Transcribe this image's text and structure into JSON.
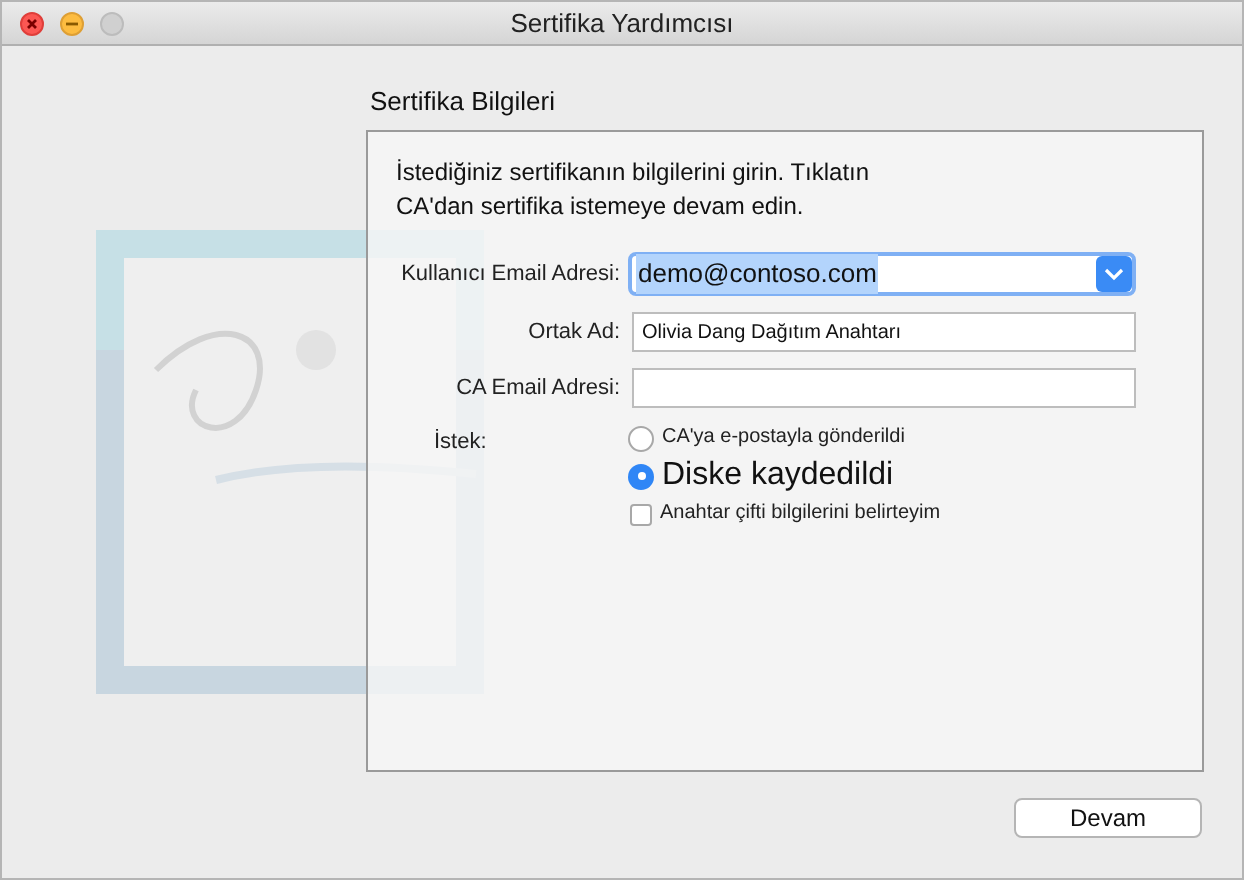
{
  "window": {
    "title": "Sertifika Yardımcısı"
  },
  "heading": "Sertifika Bilgileri",
  "intro": "İstediğiniz sertifikanın bilgilerini girin. Tıklatın\nCA'dan sertifika istemeye devam edin.",
  "fields": [
    {
      "kind": "dropdown",
      "label": "Kullanıcı Email Adresi:",
      "value": "demo@contoso.com"
    },
    {
      "kind": "text",
      "label": "Ortak Ad:",
      "value": "Olivia Dang Dağıtım Anahtarı"
    },
    {
      "kind": "text",
      "label": "CA Email Adresi:"
    }
  ],
  "request": {
    "label": "İstek:",
    "options": [
      {
        "kind": "radio",
        "label": "CA'ya e-postayla gönderildi",
        "selected": false
      },
      {
        "kind": "radio",
        "label": "Diske kaydedildi",
        "selected": true
      },
      {
        "kind": "checkbox",
        "label": "Anahtar çifti bilgilerini belirteyim",
        "checked": false
      }
    ]
  },
  "buttons": [
    "Devam"
  ]
}
